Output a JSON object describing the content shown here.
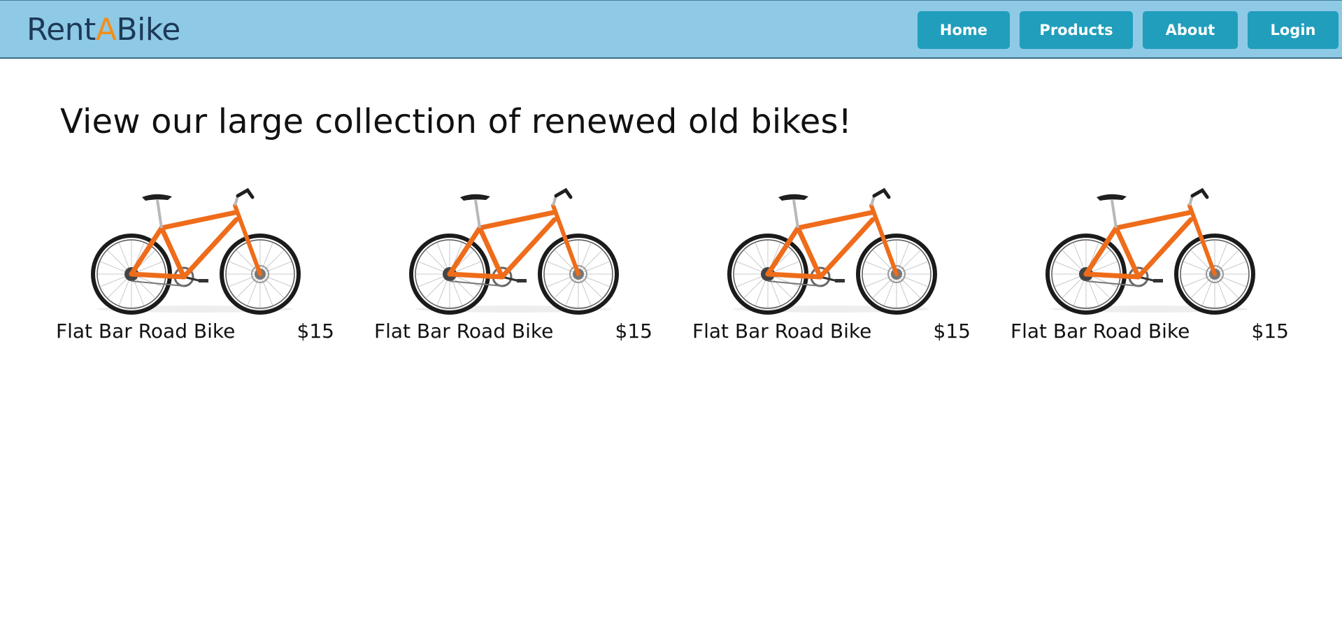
{
  "logo": {
    "part1": "Rent",
    "part2": "A",
    "part3": "Bike"
  },
  "nav": {
    "items": [
      {
        "label": "Home"
      },
      {
        "label": "Products"
      },
      {
        "label": "About"
      },
      {
        "label": "Login"
      }
    ]
  },
  "main": {
    "heading": "View our large collection of renewed old bikes!",
    "products": [
      {
        "name": "Flat Bar Road Bike",
        "price": "$15",
        "image_icon": "orange-bicycle"
      },
      {
        "name": "Flat Bar Road Bike",
        "price": "$15",
        "image_icon": "orange-bicycle"
      },
      {
        "name": "Flat Bar Road Bike",
        "price": "$15",
        "image_icon": "orange-bicycle"
      },
      {
        "name": "Flat Bar Road Bike",
        "price": "$15",
        "image_icon": "orange-bicycle"
      }
    ]
  },
  "colors": {
    "navbar": "#8ecae6",
    "button": "#219ebc",
    "logo_text": "#1d3a58",
    "logo_accent": "#f28e1c",
    "bike_frame": "#ee6c1a"
  }
}
